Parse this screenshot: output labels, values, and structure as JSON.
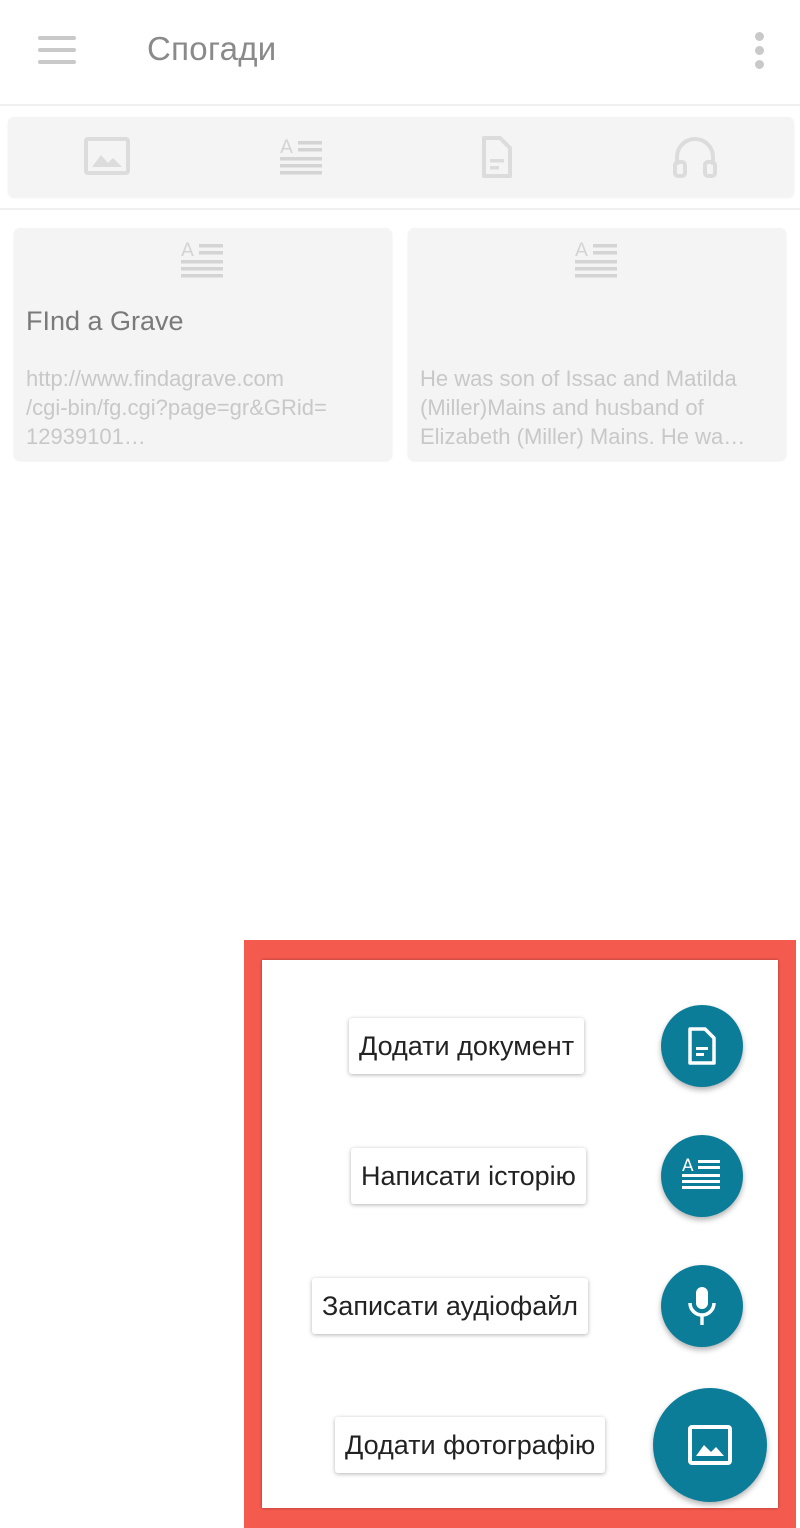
{
  "app": {
    "title": "Спогади"
  },
  "toolbar": {
    "menu_icon": "hamburger-menu-icon",
    "overflow_icon": "more-vert-icon"
  },
  "filters": [
    {
      "id": "photos",
      "icon": "image-icon"
    },
    {
      "id": "stories",
      "icon": "text-story-icon"
    },
    {
      "id": "documents",
      "icon": "document-icon"
    },
    {
      "id": "audio",
      "icon": "headphones-icon"
    }
  ],
  "cards": [
    {
      "title": "FInd a Grave",
      "excerpt": "http://www.findagrave.com\n/cgi-bin/fg.cgi?page=gr&GRid=\n12939101…",
      "icon": "text-story-icon"
    },
    {
      "title": "",
      "excerpt": "He was son of Issac and Matilda\n(Miller)Mains and husband of\nElizabeth (Miller) Mains. He wa…",
      "icon": "text-story-icon"
    }
  ],
  "speed_dial": {
    "actions": [
      {
        "label": "Додати документ",
        "icon": "document-icon"
      },
      {
        "label": "Написати історію",
        "icon": "text-story-icon"
      },
      {
        "label": "Записати аудіофайл",
        "icon": "microphone-icon"
      },
      {
        "label": "Додати фотографію",
        "icon": "image-icon"
      }
    ]
  },
  "colors": {
    "fab": "#0b7d99",
    "highlight_border": "#f55a4e",
    "muted_icon": "#dcdcdc"
  }
}
